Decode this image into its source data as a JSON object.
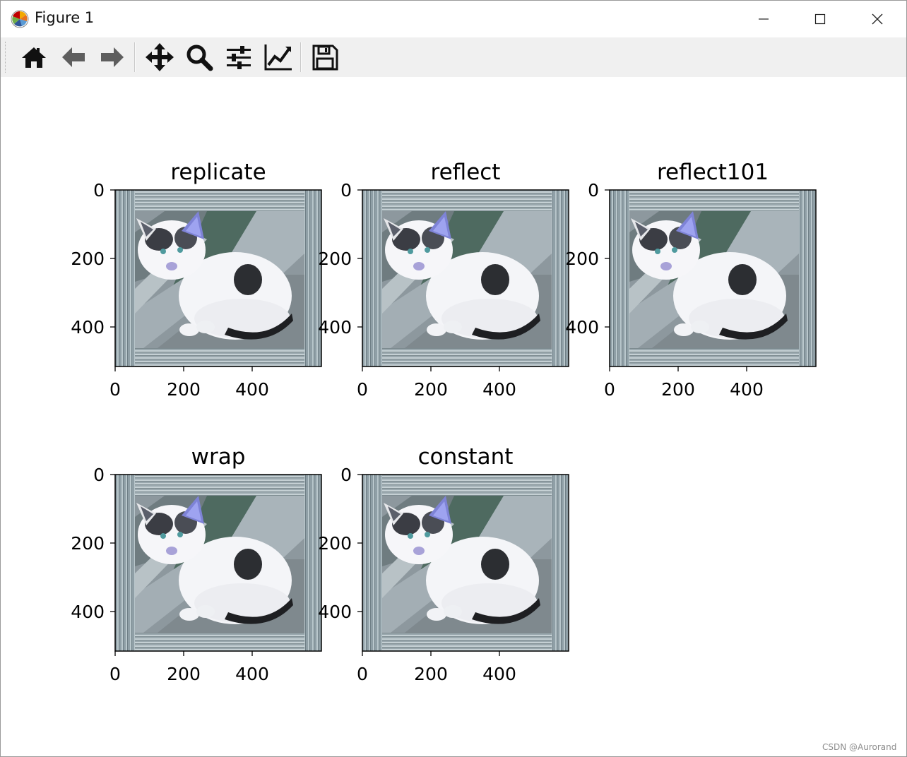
{
  "window": {
    "title": "Figure 1"
  },
  "toolbar": {
    "buttons": [
      {
        "id": "home",
        "icon": "home-icon"
      },
      {
        "id": "back",
        "icon": "arrow-left-icon"
      },
      {
        "id": "forward",
        "icon": "arrow-right-icon"
      },
      {
        "id": "pan",
        "icon": "move-icon"
      },
      {
        "id": "zoom",
        "icon": "magnifier-icon"
      },
      {
        "id": "subplots",
        "icon": "sliders-icon"
      },
      {
        "id": "edit-axes",
        "icon": "line-chart-icon"
      },
      {
        "id": "save",
        "icon": "floppy-disk-icon"
      }
    ]
  },
  "subplots": [
    {
      "title": "replicate",
      "xticks": [
        "0",
        "200",
        "400"
      ],
      "yticks": [
        "0",
        "200",
        "400"
      ]
    },
    {
      "title": "reflect",
      "xticks": [
        "0",
        "200",
        "400"
      ],
      "yticks": [
        "0",
        "200",
        "400"
      ]
    },
    {
      "title": "reflect101",
      "xticks": [
        "0",
        "200",
        "400"
      ],
      "yticks": [
        "0",
        "200",
        "400"
      ]
    },
    {
      "title": "wrap",
      "xticks": [
        "0",
        "200",
        "400"
      ],
      "yticks": [
        "0",
        "200",
        "400"
      ]
    },
    {
      "title": "constant",
      "xticks": [
        "0",
        "200",
        "400"
      ],
      "yticks": [
        "0",
        "200",
        "400"
      ]
    }
  ],
  "watermark": "CSDN @Aurorand"
}
